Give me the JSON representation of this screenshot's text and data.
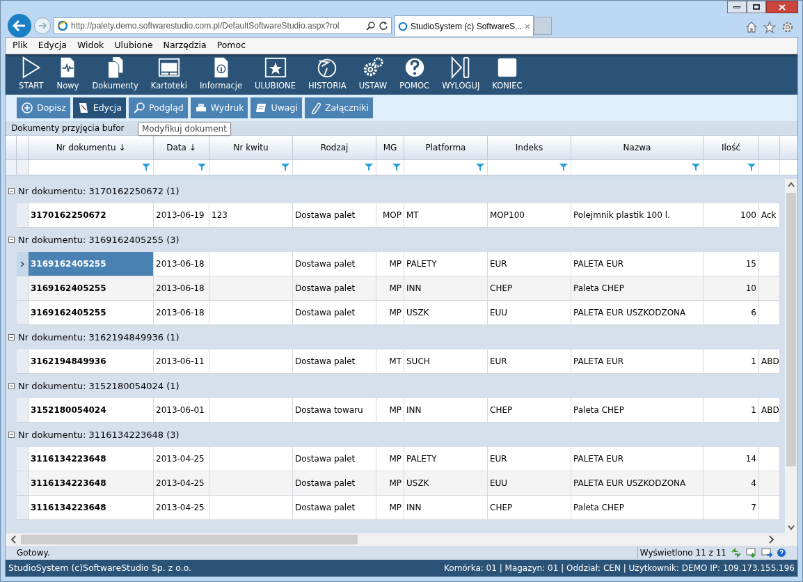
{
  "browser": {
    "address": "http://palety.demo.softwarestudio.com.pl/DefaultSoftwareStudio.aspx?rol",
    "tab_title": "StudioSystem (c) SoftwareS..."
  },
  "menu": [
    "Plik",
    "Edycja",
    "Widok",
    "Ulubione",
    "Narzędzia",
    "Pomoc"
  ],
  "toolbar": [
    {
      "label": "START",
      "kind": "play"
    },
    {
      "label": "Nowy",
      "kind": "newdoc"
    },
    {
      "label": "Dokumenty",
      "kind": "docs"
    },
    {
      "label": "Kartoteki",
      "kind": "window"
    },
    {
      "label": "Informacje",
      "kind": "info"
    },
    {
      "label": "ULUBIONE",
      "kind": "star"
    },
    {
      "label": "HISTORIA",
      "kind": "history"
    },
    {
      "label": "USTAW",
      "kind": "gears"
    },
    {
      "label": "POMOC",
      "kind": "help"
    },
    {
      "label": "WYLOGUJ",
      "kind": "logout"
    },
    {
      "label": "KONIEC",
      "kind": "stop"
    }
  ],
  "actions": [
    {
      "label": "Dopisz",
      "kind": "plus",
      "selected": false
    },
    {
      "label": "Edycja",
      "kind": "edit",
      "selected": true
    },
    {
      "label": "Podgląd",
      "kind": "magnifier",
      "selected": false
    },
    {
      "label": "Wydruk",
      "kind": "print",
      "selected": false
    },
    {
      "label": "Uwagi",
      "kind": "note",
      "selected": false
    },
    {
      "label": "Załączniki",
      "kind": "clip",
      "selected": false
    }
  ],
  "caption": "Dokumenty przyjęcia bufor",
  "tooltip": "Modyfikuj dokument",
  "table": {
    "columns": [
      "Nr dokumentu ↓",
      "Data ↓",
      "Nr kwitu",
      "Rodzaj",
      "MG",
      "Platforma",
      "Indeks",
      "Nazwa",
      "Ilość"
    ],
    "groups": [
      {
        "label": "Nr dokumentu: 3170162250672 (1)",
        "expanded": true,
        "rows": [
          {
            "selected": false,
            "cells": [
              "3170162250672",
              "2013-06-19",
              "123",
              "Dostawa palet",
              "MOP",
              "MT",
              "MOP100",
              "Polejmnik plastik 100 l.",
              "100",
              "Ack"
            ]
          }
        ]
      },
      {
        "label": "Nr dokumentu: 3169162405255 (3)",
        "expanded": true,
        "rows": [
          {
            "selected": true,
            "cells": [
              "3169162405255",
              "2013-06-18",
              "",
              "Dostawa palet",
              "MP",
              "PALETY",
              "EUR",
              "PALETA EUR",
              "15",
              ""
            ]
          },
          {
            "selected": false,
            "cells": [
              "3169162405255",
              "2013-06-18",
              "",
              "Dostawa palet",
              "MP",
              "INN",
              "CHEP",
              "Paleta CHEP",
              "10",
              ""
            ]
          },
          {
            "selected": false,
            "cells": [
              "3169162405255",
              "2013-06-18",
              "",
              "Dostawa palet",
              "MP",
              "USZK",
              "EUU",
              "PALETA EUR USZKODZONA",
              "6",
              ""
            ]
          }
        ]
      },
      {
        "label": "Nr dokumentu: 3162194849936 (1)",
        "expanded": true,
        "rows": [
          {
            "selected": false,
            "cells": [
              "3162194849936",
              "2013-06-11",
              "",
              "Dostawa palet",
              "MT",
              "SUCH",
              "EUR",
              "PALETA EUR",
              "1",
              "ABD"
            ]
          }
        ]
      },
      {
        "label": "Nr dokumentu: 3152180054024 (1)",
        "expanded": true,
        "rows": [
          {
            "selected": false,
            "cells": [
              "3152180054024",
              "2013-06-01",
              "",
              "Dostawa towaru",
              "MP",
              "INN",
              "CHEP",
              "Paleta CHEP",
              "1",
              "ABD"
            ]
          }
        ]
      },
      {
        "label": "Nr dokumentu: 3116134223648 (3)",
        "expanded": true,
        "rows": [
          {
            "selected": false,
            "cells": [
              "3116134223648",
              "2013-04-25",
              "",
              "Dostawa palet",
              "MP",
              "PALETY",
              "EUR",
              "PALETA EUR",
              "14",
              ""
            ]
          },
          {
            "selected": false,
            "cells": [
              "3116134223648",
              "2013-04-25",
              "",
              "Dostawa palet",
              "MP",
              "USZK",
              "EUU",
              "PALETA EUR USZKODZONA",
              "4",
              ""
            ]
          },
          {
            "selected": false,
            "cells": [
              "3116134223648",
              "2013-04-25",
              "",
              "Dostawa palet",
              "MP",
              "INN",
              "CHEP",
              "Paleta CHEP",
              "7",
              ""
            ]
          }
        ]
      }
    ]
  },
  "status": {
    "text": "Gotowy.",
    "count": "Wyświetlono 11 z 11"
  },
  "footer": {
    "left": "StudioSystem (c)SoftwareStudio Sp. z o.o.",
    "right": "Komórka: 01 | Magazyn: 01 | Oddział: CEN | Użytkownik: DEMO IP: 109.173.155.196"
  }
}
